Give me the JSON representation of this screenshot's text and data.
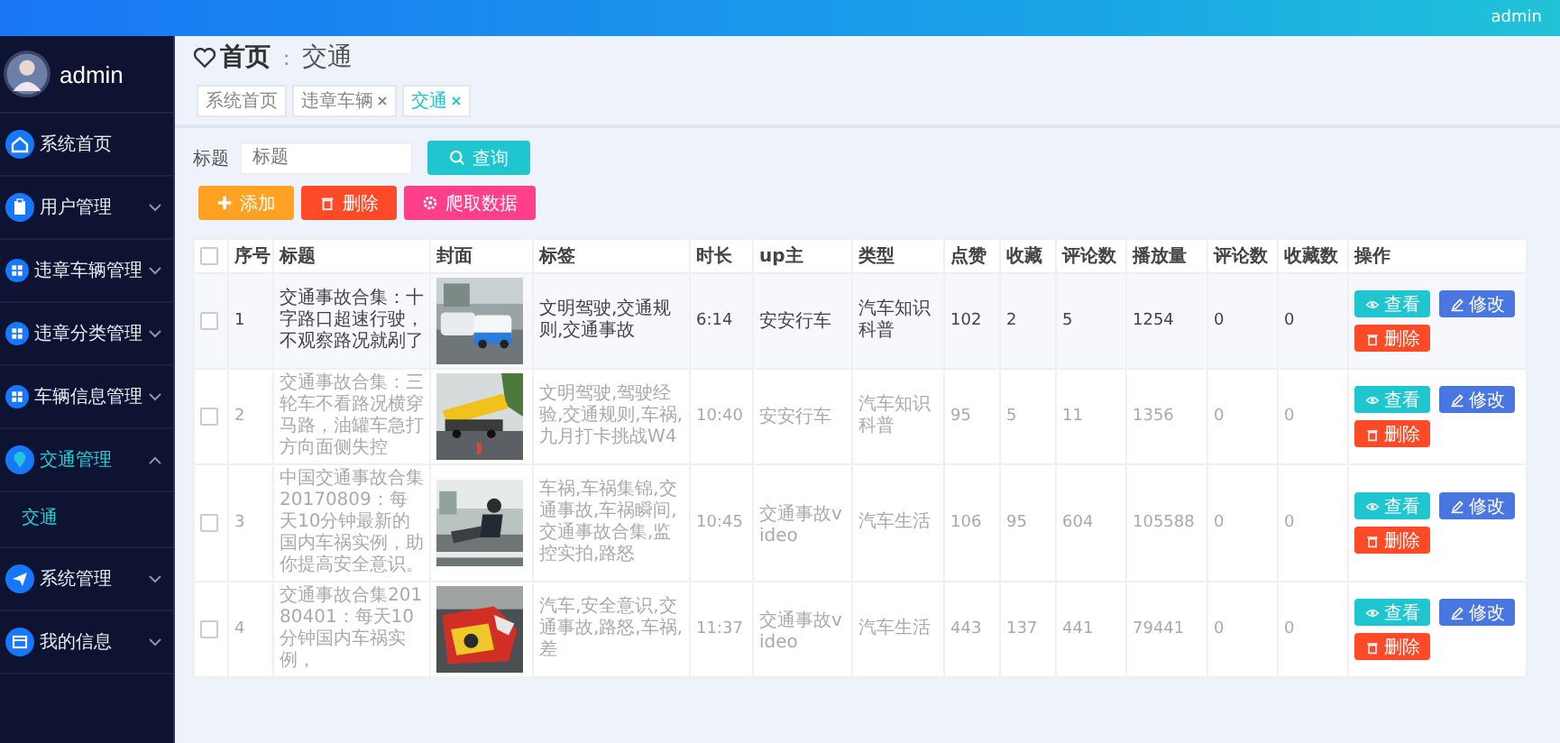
{
  "top_bar": {
    "user": "admin"
  },
  "sidebar": {
    "user": {
      "name": "admin"
    },
    "items": [
      {
        "label": "系统首页",
        "active": false
      },
      {
        "label": "用户管理",
        "active": false,
        "expanded": false
      },
      {
        "label": "违章车辆管理",
        "active": false,
        "expanded": false
      },
      {
        "label": "违章分类管理",
        "active": false,
        "expanded": false
      },
      {
        "label": "车辆信息管理",
        "active": false,
        "expanded": false
      },
      {
        "label": "交通管理",
        "active": true,
        "expanded": true,
        "children": [
          {
            "label": "交通",
            "selected": true
          }
        ]
      },
      {
        "label": "系统管理",
        "active": false,
        "expanded": false
      },
      {
        "label": "我的信息",
        "active": false,
        "expanded": false
      }
    ]
  },
  "breadcrumb": {
    "home": "首页",
    "separator": ":",
    "current": "交通"
  },
  "tags": [
    {
      "label": "系统首页",
      "selected": false,
      "closable": false
    },
    {
      "label": "违章车辆",
      "selected": false,
      "closable": true
    },
    {
      "label": "交通",
      "selected": true,
      "closable": true
    }
  ],
  "search": {
    "label": "标题",
    "placeholder": "标题",
    "button": "查询"
  },
  "toolbar": [
    {
      "label": "添加"
    },
    {
      "label": "删除"
    },
    {
      "label": "爬取数据"
    }
  ],
  "table": {
    "header_checked": false,
    "columns": [
      "序号",
      "标题",
      "封面",
      "标签",
      "时长",
      "up主",
      "类型",
      "点赞",
      "收藏",
      "评论数",
      "播放量",
      "评论数",
      "收藏数",
      "操作"
    ],
    "rows": [
      {
        "checked": false,
        "highlighted": true,
        "cells": [
          "1",
          "交通事故合集：十字路口超速行驶，不观察路况就剐了",
          {
            "kind": "picture"
          },
          "文明驾驶,交通规则,交通事故",
          "6:14",
          "安安行车",
          "汽车知识科普",
          "102",
          "2",
          "5",
          "1254",
          "0",
          "0"
        ],
        "actions": [
          "查看",
          "修改",
          "删除"
        ]
      },
      {
        "checked": false,
        "highlighted": false,
        "cells": [
          "2",
          "交通事故合集：三轮车不看路况横穿马路，油罐车急打方向面侧失控",
          {
            "kind": "picture"
          },
          "文明驾驶,驾驶经验,交通规则,车祸,九月打卡挑战W4",
          "10:40",
          "安安行车",
          "汽车知识科普",
          "95",
          "5",
          "11",
          "1356",
          "0",
          "0"
        ],
        "actions": [
          "查看",
          "修改",
          "删除"
        ]
      },
      {
        "checked": false,
        "highlighted": false,
        "cells": [
          "3",
          "中国交通事故合集20170809：每天10分钟最新的国内车祸实例，助你提高安全意识。",
          {
            "kind": "picture"
          },
          "车祸,车祸集锦,交通事故,车祸瞬间,交通事故合集,监控实拍,路怒",
          "10:45",
          "交通事故video",
          "汽车生活",
          "106",
          "95",
          "604",
          "105588",
          "0",
          "0"
        ],
        "actions": [
          "查看",
          "修改",
          "删除"
        ]
      },
      {
        "checked": false,
        "highlighted": false,
        "cells": [
          "4",
          "交通事故合集20180401：每天10分钟国内车祸实例，",
          {
            "kind": "picture"
          },
          "汽车,安全意识,交通事故,路怒,车祸,差",
          "11:37",
          "交通事故video",
          "汽车生活",
          "443",
          "137",
          "441",
          "79441",
          "0",
          "0"
        ],
        "actions": [
          "查看",
          "修改",
          "删除"
        ]
      }
    ]
  }
}
